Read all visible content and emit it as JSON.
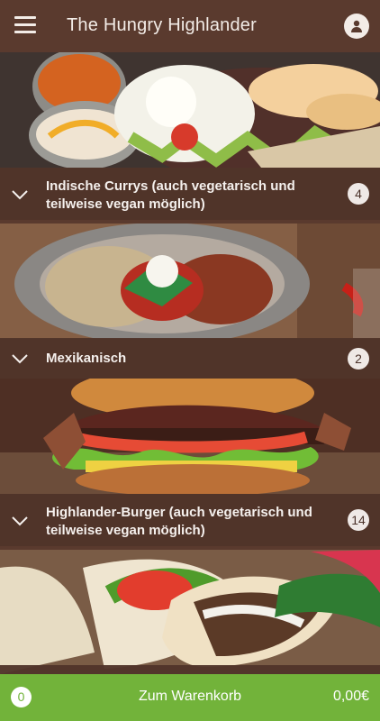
{
  "app": {
    "title": "The Hungry Highlander",
    "menu_icon": "hamburger-menu-icon",
    "profile_icon": "user-profile-icon"
  },
  "categories": [
    {
      "label": "Indische Currys (auch vegetarisch und teilweise vegan möglich)",
      "count": "4"
    },
    {
      "label": "Mexikanisch",
      "count": "2"
    },
    {
      "label": "Highlander-Burger (auch vegetarisch und teilweise vegan möglich)",
      "count": "14"
    },
    {
      "label": "",
      "count": ""
    }
  ],
  "cart": {
    "count": "0",
    "label": "Zum Warenkorb",
    "total": "0,00€"
  },
  "colors": {
    "header": "#5a3a2e",
    "category_bar": "#50342a",
    "accent": "#72b33a",
    "text": "#f5f0ed"
  }
}
